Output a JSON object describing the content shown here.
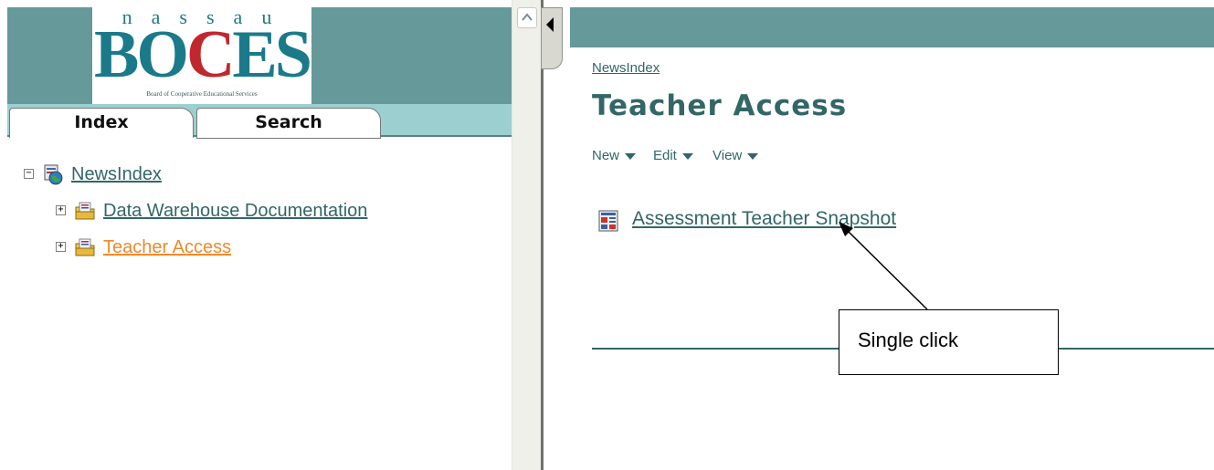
{
  "logo": {
    "top_letters": "nassau",
    "main": "BOCES",
    "subtitle": "Board of Cooperative Educational Services"
  },
  "left_tabs": [
    {
      "label": "Index",
      "selected": true
    },
    {
      "label": "Search",
      "selected": false
    }
  ],
  "tree": {
    "root": {
      "label": "NewsIndex",
      "expander": "−"
    },
    "children": [
      {
        "label": "Data Warehouse Documentation",
        "expander": "+"
      },
      {
        "label": "Teacher Access",
        "expander": "+",
        "active": true
      }
    ]
  },
  "main": {
    "breadcrumb": "NewsIndex",
    "title": "Teacher Access",
    "menu": [
      {
        "label": "New"
      },
      {
        "label": "Edit"
      },
      {
        "label": "View"
      }
    ],
    "item_link": "Assessment Teacher Snapshot"
  },
  "annotation": {
    "callout": "Single click"
  },
  "colors": {
    "header_teal": "#669999",
    "link_teal": "#336666",
    "active_orange": "#ee8a2c",
    "tab_strip": "#9ccfcf"
  }
}
